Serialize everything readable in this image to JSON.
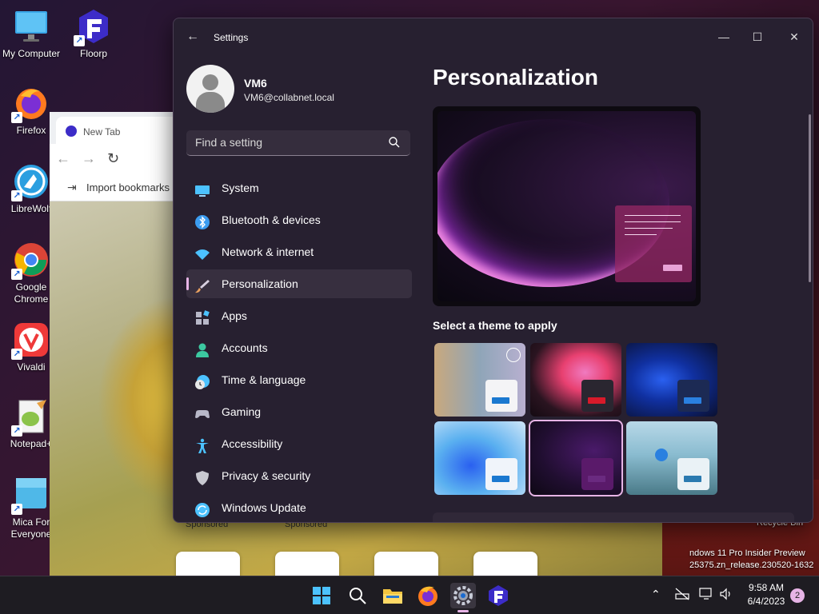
{
  "desktop": {
    "icons": [
      {
        "label": "My Computer",
        "icon": "monitor-icon"
      },
      {
        "label": "Floorp",
        "icon": "floorp-icon"
      },
      {
        "label": "Firefox",
        "icon": "firefox-icon"
      },
      {
        "label": "LibreWolf",
        "icon": "librewolf-icon"
      },
      {
        "label": "Google Chrome",
        "icon": "chrome-icon"
      },
      {
        "label": "Vivaldi",
        "icon": "vivaldi-icon"
      },
      {
        "label": "Notepad+",
        "icon": "notepadplusplus-icon"
      },
      {
        "label": "Mica For Everyone",
        "icon": "mica-icon"
      }
    ],
    "recycle_bin_label": "Recycle Bin",
    "watermark_line1": "ndows 11 Pro Insider Preview",
    "watermark_line2": "25375.zn_release.230520-1632"
  },
  "browser": {
    "tab_label": "New Tab",
    "bookmarks_import": "Import bookmarks",
    "sponsored_1": "Sponsored",
    "sponsored_2": "Sponsored"
  },
  "settings": {
    "window_title": "Settings",
    "user": {
      "name": "VM6",
      "email": "VM6@collabnet.local"
    },
    "search": {
      "placeholder": "Find a setting"
    },
    "nav": [
      {
        "label": "System",
        "icon": "display-icon",
        "color": "#4cc2ff"
      },
      {
        "label": "Bluetooth & devices",
        "icon": "bluetooth-icon",
        "color": "#3b9cf0"
      },
      {
        "label": "Network & internet",
        "icon": "wifi-icon",
        "color": "#4cc2ff"
      },
      {
        "label": "Personalization",
        "icon": "brush-icon",
        "color": "#e8a060",
        "active": true
      },
      {
        "label": "Apps",
        "icon": "apps-icon",
        "color": "#b8b8c8"
      },
      {
        "label": "Accounts",
        "icon": "person-icon",
        "color": "#3cc8a0"
      },
      {
        "label": "Time & language",
        "icon": "clock-globe-icon",
        "color": "#4cc2ff"
      },
      {
        "label": "Gaming",
        "icon": "gamepad-icon",
        "color": "#b8b8c8"
      },
      {
        "label": "Accessibility",
        "icon": "accessibility-icon",
        "color": "#4cc2ff"
      },
      {
        "label": "Privacy & security",
        "icon": "shield-icon",
        "color": "#c8c8d0"
      },
      {
        "label": "Windows Update",
        "icon": "update-icon",
        "color": "#4cc2ff"
      }
    ],
    "page_title": "Personalization",
    "theme_section_label": "Select a theme to apply",
    "accent_color": "#e7b4e6"
  },
  "taskbar": {
    "time": "9:58 AM",
    "date": "6/4/2023",
    "notification_count": "2"
  }
}
